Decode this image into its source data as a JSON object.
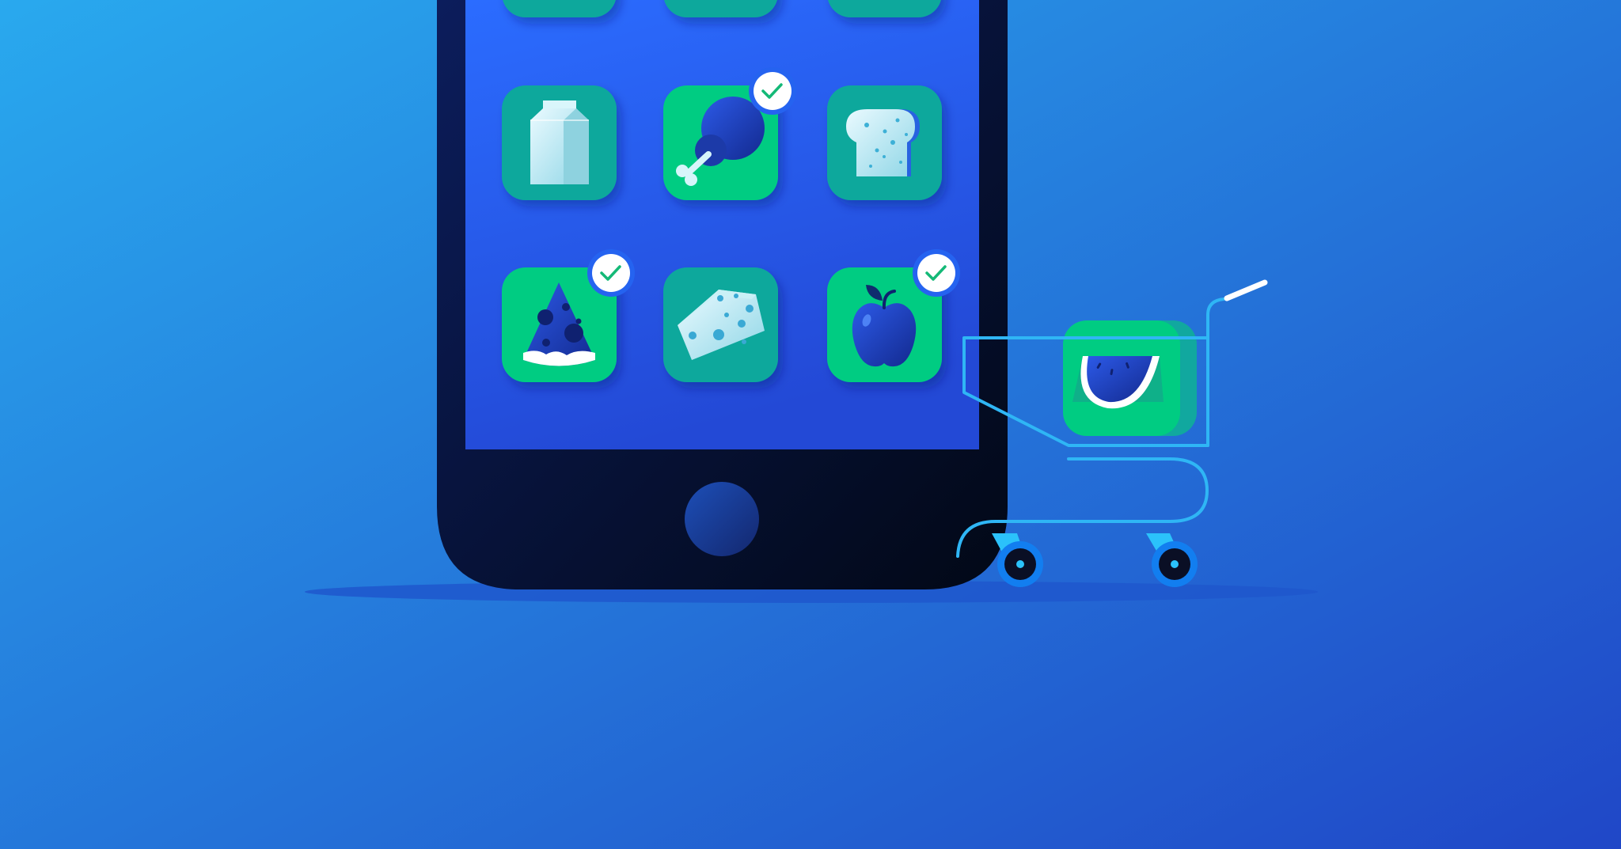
{
  "colors": {
    "bg_top_left": "#29a9ee",
    "bg_bottom_right": "#2047c7",
    "phone_body": "#0a1644",
    "screen_top": "#2b6cff",
    "screen_bottom": "#2349d6",
    "tile_selected": "#00cc82",
    "tile_unselected": "#0fa89c",
    "check_mark": "#14b977",
    "cart_outline": "#2fb6f5",
    "wheel_ring": "#127ef0"
  },
  "grocery_items": [
    {
      "name": "milk-carton",
      "selected": false
    },
    {
      "name": "chicken-drumstick",
      "selected": true
    },
    {
      "name": "bread-loaf",
      "selected": false
    },
    {
      "name": "pizza-slice",
      "selected": true
    },
    {
      "name": "cheese-wedge",
      "selected": false
    },
    {
      "name": "apple",
      "selected": true
    }
  ],
  "cart_item": "watermelon-slice"
}
